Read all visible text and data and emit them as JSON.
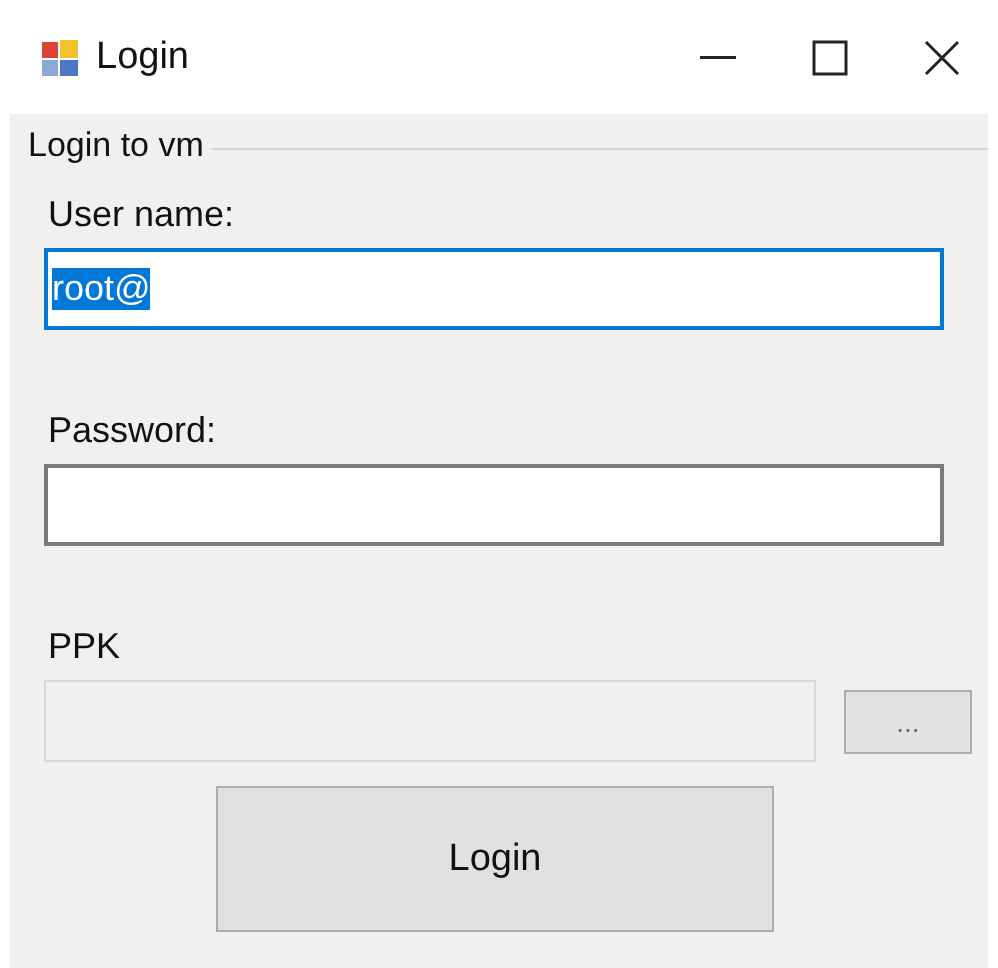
{
  "window": {
    "title": "Login"
  },
  "group": {
    "title": "Login to vm"
  },
  "fields": [
    {
      "label": "User name:",
      "value": "root@",
      "text_selected": true,
      "focused": true,
      "disabled": false
    },
    {
      "label": "Password:",
      "focused": false,
      "disabled": false
    },
    {
      "label": "PPK",
      "focused": false,
      "disabled": true,
      "browse": "..."
    }
  ],
  "buttons": [
    "Login"
  ]
}
